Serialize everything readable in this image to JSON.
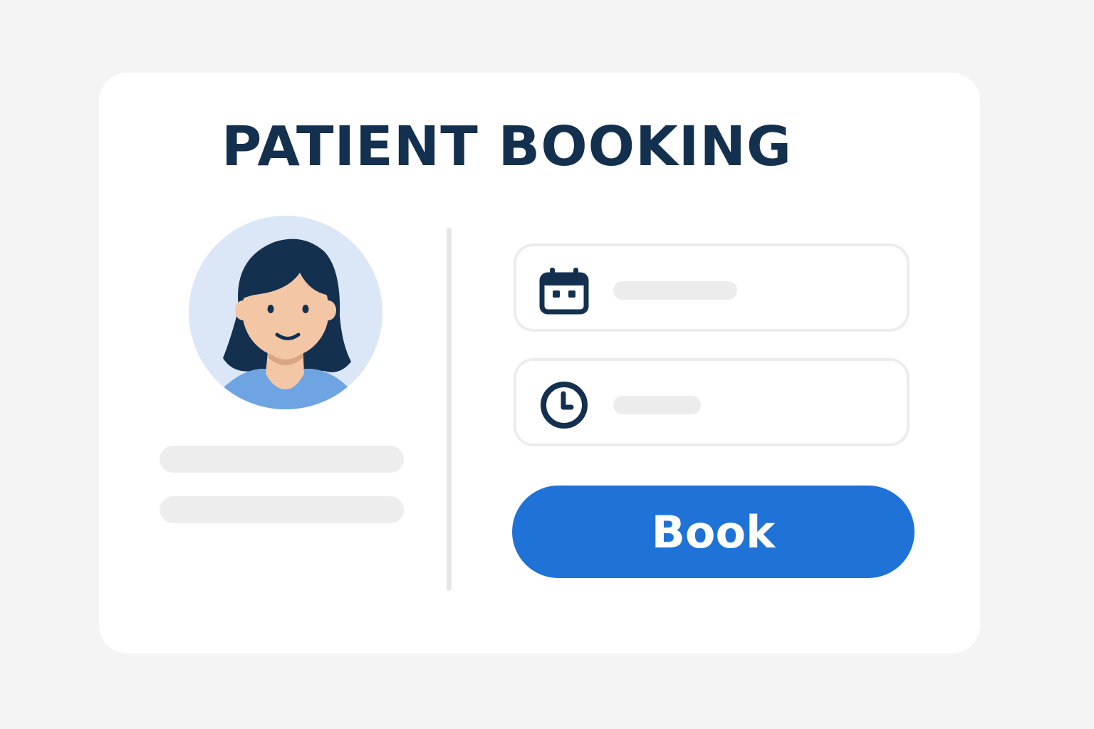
{
  "header": {
    "title": "PATIENT BOOKING"
  },
  "patient": {
    "avatar_icon": "female-patient-avatar"
  },
  "form": {
    "date_field": {
      "icon": "calendar-icon",
      "value": ""
    },
    "time_field": {
      "icon": "clock-icon",
      "value": ""
    },
    "book_label": "Book"
  },
  "colors": {
    "title": "#14304f",
    "accent": "#1f72d6",
    "avatar_background": "#dbe7f6",
    "placeholder_bar": "#ededed",
    "field_border": "#ececec"
  }
}
